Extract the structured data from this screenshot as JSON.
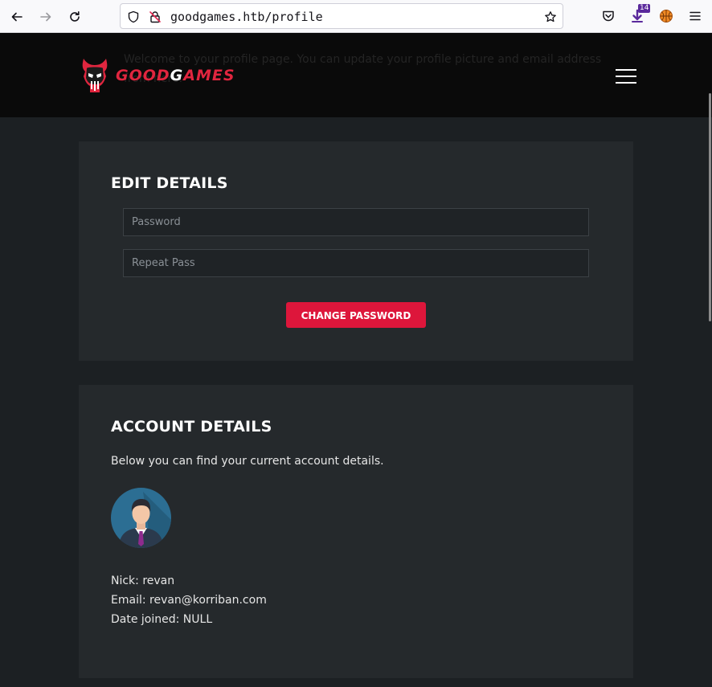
{
  "browser": {
    "url": "goodgames.htb/profile",
    "extension_badge": "14"
  },
  "header": {
    "faded_welcome": "Welcome to your profile page. You can update your profile picture and email address from here.",
    "logo_part1": "GOOD",
    "logo_part2": "G",
    "logo_part3": "AMES"
  },
  "edit_details": {
    "title": "EDIT DETAILS",
    "password_placeholder": "Password",
    "repeat_placeholder": "Repeat Pass",
    "button_label": "CHANGE PASSWORD"
  },
  "account_details": {
    "title": "ACCOUNT DETAILS",
    "intro": "Below you can find your current account details.",
    "nick": "Nick: revan",
    "email": "Email: revan@korriban.com",
    "date_joined": "Date joined: NULL"
  },
  "colors": {
    "accent": "#dd163b",
    "page_bg": "#1c2023",
    "card_bg": "#25292c",
    "header_bg": "#0a0a0a"
  }
}
